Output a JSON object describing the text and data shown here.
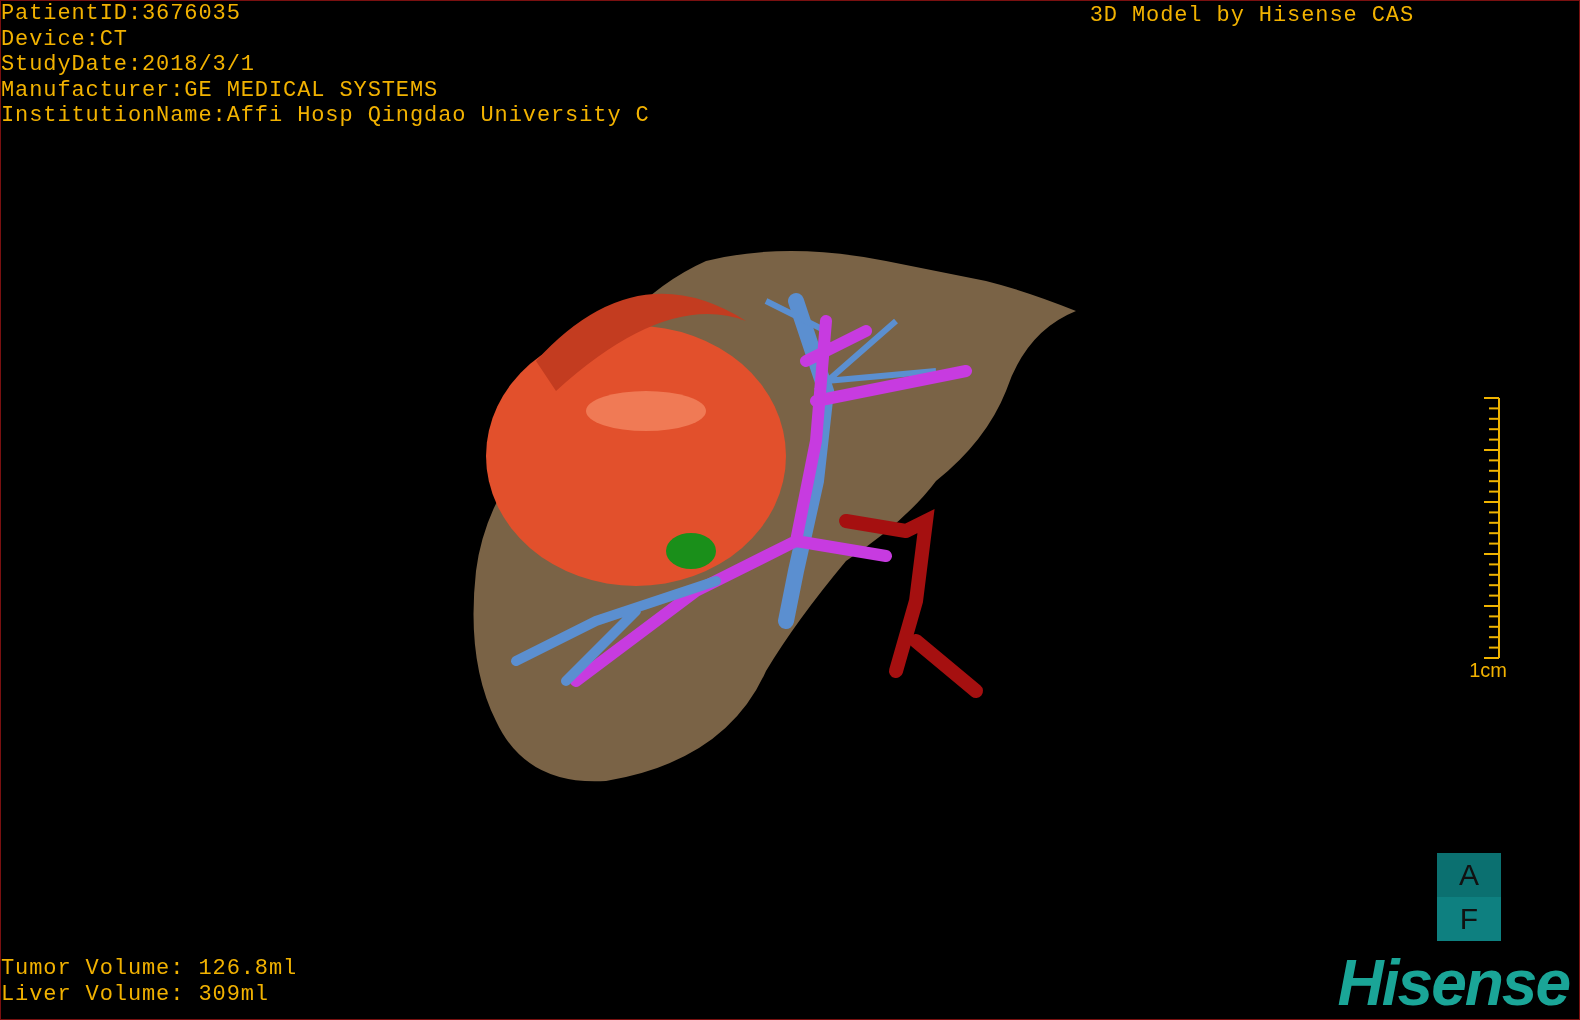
{
  "info_lines": [
    "PatientID:3676035",
    "Device:CT",
    "StudyDate:2018/3/1",
    "Manufacturer:GE MEDICAL SYSTEMS",
    "InstitutionName:Affi Hosp Qingdao University C"
  ],
  "title": "3D Model by Hisense CAS",
  "scale": {
    "label": "1cm"
  },
  "orientation": [
    "A",
    "F"
  ],
  "volumes": [
    "Tumor Volume: 126.8ml",
    "Liver Volume: 309ml"
  ],
  "logo": "Hisense"
}
